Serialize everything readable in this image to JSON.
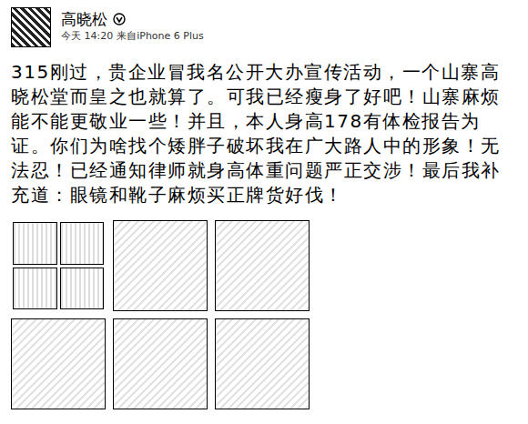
{
  "post": {
    "author": "高晓松",
    "time": "今天 14:20",
    "source": "来自iPhone 6 Plus",
    "text": "315刚过，贵企业冒我名公开大办宣传活动，一个山寨高晓松堂而皇之也就算了。可我已经瘦身了好吧！山寨麻烦能不能更敬业一些！并且，本人身高178有体检报告为证。你们为啥找个矮胖子破坏我在广大路人中的形象！无法忍！已经通知律师就身高体重问题严正交涉！最后我补充道：眼镜和靴子麻烦买正牌货好伐！",
    "images": [
      {
        "kind": "collage"
      },
      {
        "kind": "photo"
      },
      {
        "kind": "photo"
      },
      {
        "kind": "photo"
      },
      {
        "kind": "photo"
      },
      {
        "kind": "photo"
      }
    ]
  }
}
